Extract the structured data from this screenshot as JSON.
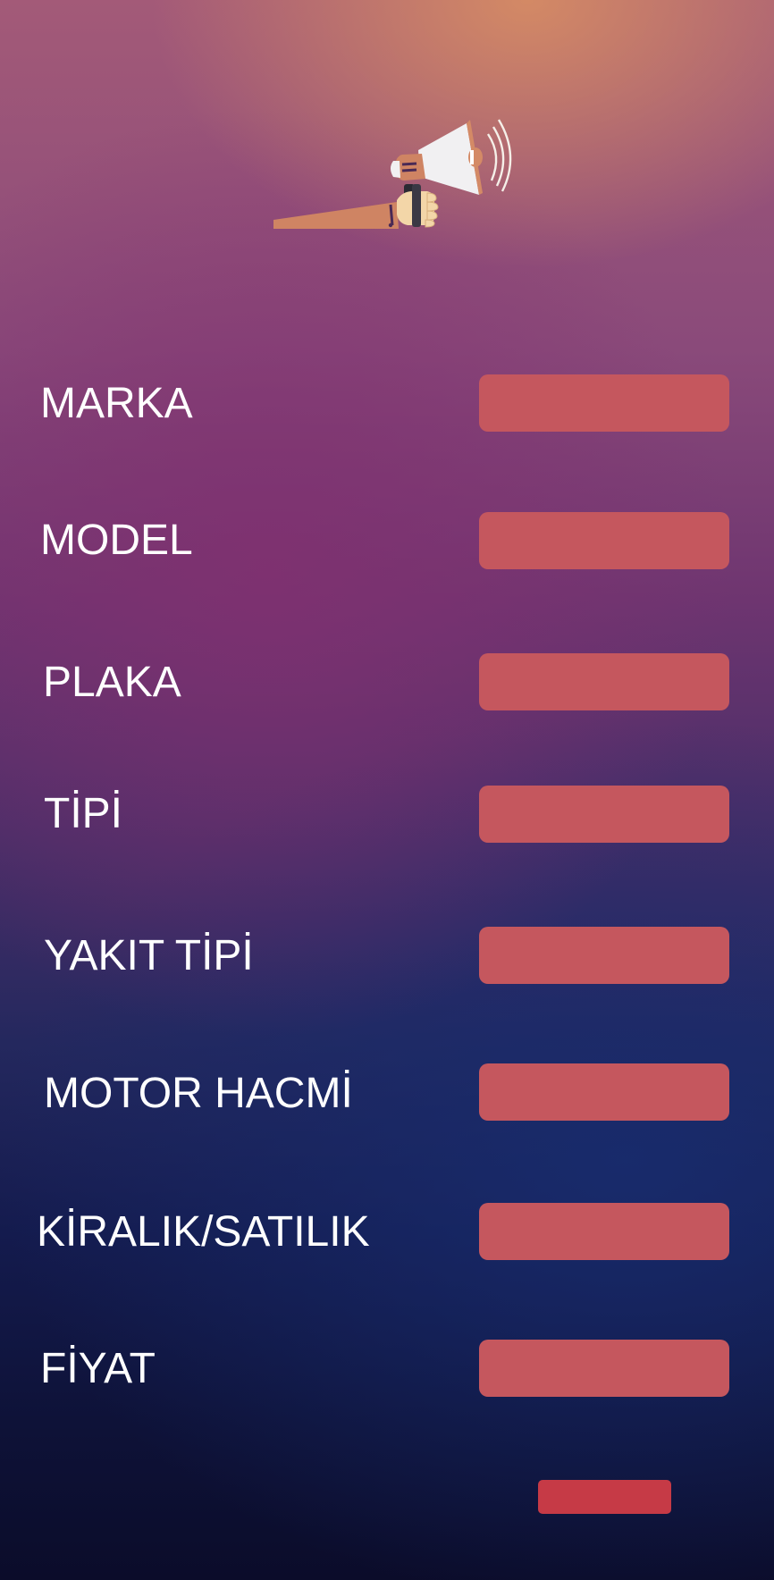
{
  "header": {
    "logo_icon": "megaphone-icon"
  },
  "form": {
    "fields": [
      {
        "label": "MARKA",
        "value": "",
        "placeholder": ""
      },
      {
        "label": "MODEL",
        "value": "",
        "placeholder": ""
      },
      {
        "label": "PLAKA",
        "value": "",
        "placeholder": ""
      },
      {
        "label": "TİPİ",
        "value": "",
        "placeholder": ""
      },
      {
        "label": "YAKIT TİPİ",
        "value": "",
        "placeholder": ""
      },
      {
        "label": "MOTOR HACMİ",
        "value": "",
        "placeholder": ""
      },
      {
        "label": "KİRALIK/SATILIK",
        "value": "",
        "placeholder": ""
      },
      {
        "label": "FİYAT",
        "value": "",
        "placeholder": ""
      }
    ],
    "submit_label": ""
  },
  "colors": {
    "field_background": "#c5575e",
    "submit_background": "#c63a46",
    "label_text": "#ffffff",
    "background_top": "#a35a78",
    "background_middle": "#6e3570",
    "background_bottom": "#0b0c2a"
  }
}
